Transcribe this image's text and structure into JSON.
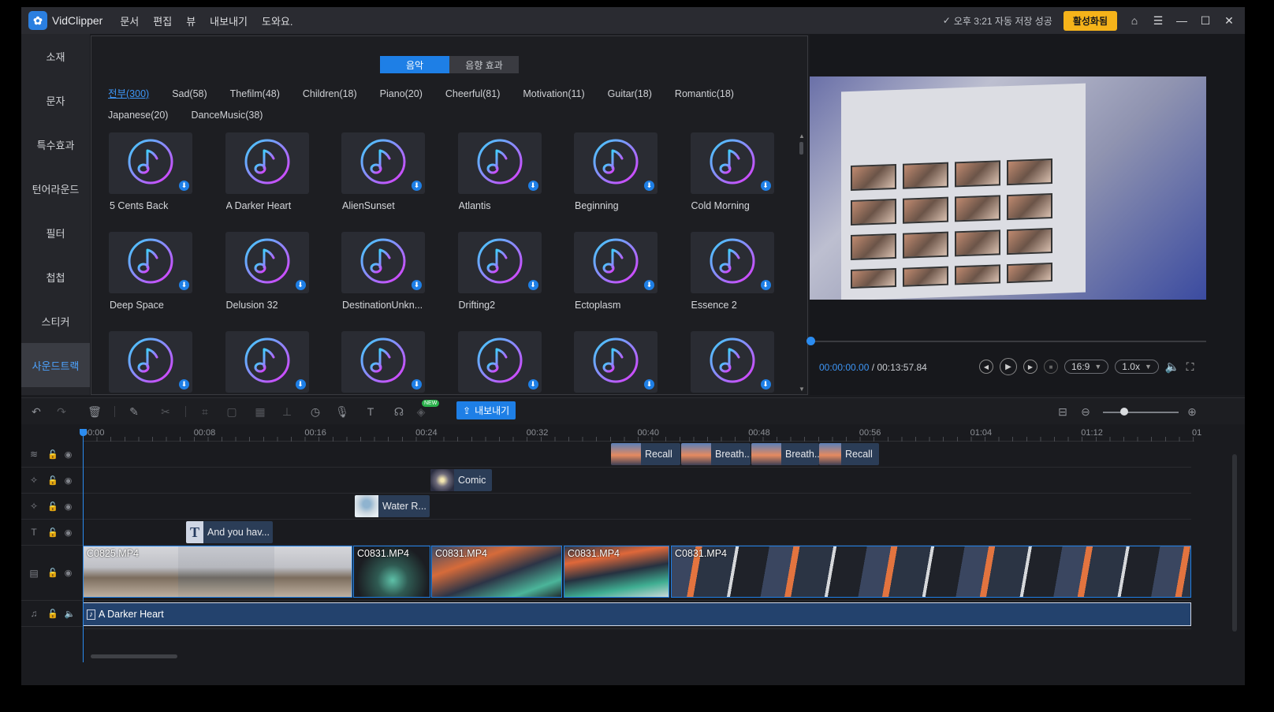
{
  "app": {
    "name": "VidClipper",
    "menu": [
      "문서",
      "편집",
      "뷰",
      "내보내기",
      "도와요."
    ],
    "save_status": "오후 3:21 자동 저장 성공",
    "activate_label": "활성화됨"
  },
  "sidebar": {
    "items": [
      {
        "label": "소재"
      },
      {
        "label": "문자"
      },
      {
        "label": "특수효과"
      },
      {
        "label": "턴어라운드"
      },
      {
        "label": "필터"
      },
      {
        "label": "첩첩"
      },
      {
        "label": "스티커"
      },
      {
        "label": "사운드트랙"
      }
    ],
    "active_index": 7
  },
  "library": {
    "tabs": [
      "음악",
      "음향 효과"
    ],
    "active_tab": 0,
    "categories": [
      "전부(300)",
      "Sad(58)",
      "Thefilm(48)",
      "Children(18)",
      "Piano(20)",
      "Cheerful(81)",
      "Motivation(11)",
      "Guitar(18)",
      "Romantic(18)",
      "Japanese(20)",
      "DanceMusic(38)"
    ],
    "active_category": 0,
    "items": [
      {
        "title": "5 Cents Back",
        "download": true
      },
      {
        "title": "A Darker Heart",
        "download": false
      },
      {
        "title": "AlienSunset",
        "download": true
      },
      {
        "title": "Atlantis",
        "download": true
      },
      {
        "title": "Beginning",
        "download": true
      },
      {
        "title": "Cold Morning",
        "download": true
      },
      {
        "title": "Deep Space",
        "download": true
      },
      {
        "title": "Delusion 32",
        "download": true
      },
      {
        "title": "DestinationUnkn...",
        "download": true
      },
      {
        "title": "Drifting2",
        "download": true
      },
      {
        "title": "Ectoplasm",
        "download": true
      },
      {
        "title": "Essence 2",
        "download": true
      },
      {
        "title": "",
        "download": true
      },
      {
        "title": "",
        "download": true
      },
      {
        "title": "",
        "download": true
      },
      {
        "title": "",
        "download": true
      },
      {
        "title": "",
        "download": true
      },
      {
        "title": "",
        "download": true
      }
    ]
  },
  "preview": {
    "current_time": "00:00:00.00",
    "separator": "/",
    "total_time": "00:13:57.84",
    "aspect": "16:9",
    "speed": "1.0x"
  },
  "toolbar": {
    "export_label": "내보내기",
    "new_badge": "NEW"
  },
  "timeline": {
    "ruler_labels": [
      "00:00",
      "00:08",
      "00:16",
      "00:24",
      "00:32",
      "00:40",
      "00:48",
      "00:56",
      "01:04",
      "01:12",
      "01"
    ],
    "pip_clips": [
      "Recall",
      "Breath...",
      "Breath...",
      "Recall"
    ],
    "effect_clip_1": "Comic",
    "effect_clip_2": "Water R...",
    "text_clip": "And you hav...",
    "video_clips": [
      "C0825.MP4",
      "C0831.MP4",
      "C0831.MP4",
      "C0831.MP4",
      "C0831.MP4"
    ],
    "audio_clip": "A Darker Heart"
  },
  "colors": {
    "accent": "#1e7fe6",
    "activate": "#f5b31a",
    "sidebar_active_text": "#4da3ff"
  }
}
